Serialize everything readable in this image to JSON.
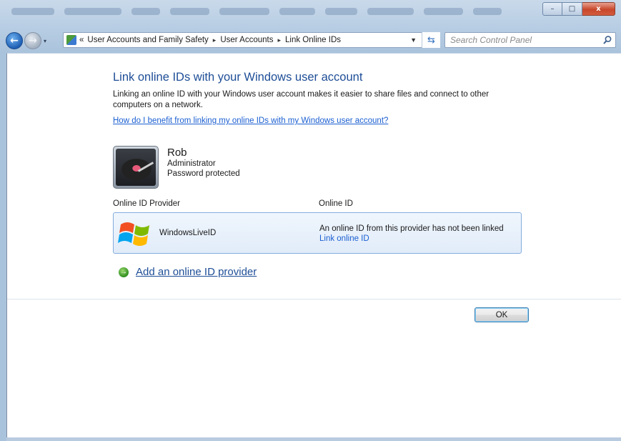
{
  "window": {
    "minimize_glyph": "–",
    "maximize_glyph": "□",
    "close_glyph": "x"
  },
  "navbar": {
    "back_glyph": "←",
    "forward_glyph": "→",
    "dropdown_glyph": "▾",
    "breadcrumb_prefix": "«",
    "breadcrumbs": [
      "User Accounts and Family Safety",
      "User Accounts",
      "Link Online IDs"
    ],
    "separator_glyph": "▸",
    "address_dropdown_glyph": "▼",
    "refresh_glyph": "⇆",
    "search_placeholder": "Search Control Panel"
  },
  "page": {
    "title": "Link online IDs with your Windows user account",
    "description": "Linking an online ID with your Windows user account makes it easier to share files and connect to other computers on a network.",
    "help_link": "How do I benefit from linking my online IDs with my Windows user account?"
  },
  "user": {
    "name": "Rob",
    "role": "Administrator",
    "status": "Password protected"
  },
  "table": {
    "headers": [
      "Online ID Provider",
      "Online ID"
    ],
    "rows": [
      {
        "provider": "WindowsLiveID",
        "status": "An online ID from this provider has not been linked",
        "action": "Link online ID"
      }
    ]
  },
  "add_provider": {
    "label": "Add an online ID provider",
    "icon_glyph": "→"
  },
  "footer": {
    "ok_label": "OK"
  }
}
